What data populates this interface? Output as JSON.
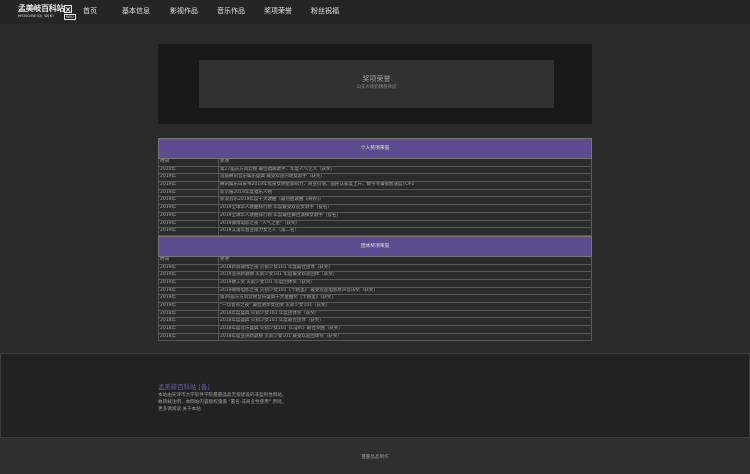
{
  "nav": {
    "logo_main": "孟美岐百科站",
    "logo_sub": "MENGMEIQI WIKI",
    "logo_tag": "WIKI",
    "items": [
      {
        "label": "首页"
      },
      {
        "label": "基本信息"
      },
      {
        "label": "影视作品"
      },
      {
        "label": "音乐作品"
      },
      {
        "label": "奖项荣誉"
      },
      {
        "label": "粉丝祝福"
      }
    ]
  },
  "banner": {
    "title": "奖项荣誉",
    "subtitle": "山支大岐奶精粉禅说"
  },
  "personal": {
    "heading": "个人奖项荣誉",
    "col_time": "时间",
    "col_award": "奖项",
    "rows": [
      {
        "time": "2020年",
        "award": "第27届东方风云榜 最佳唱跳歌手、年度人气艺人（获奖）"
      },
      {
        "time": "2019年",
        "award": "首届腾讯音乐娱乐盛典 最受欢迎内地女歌手（获奖）"
      },
      {
        "time": "2019年",
        "award": "腾讯娱乐白皮书2019年优质女明星影响力、商业价值、国民认知度上升、数字专辑销售速度TOP1"
      },
      {
        "time": "2019年",
        "award": "新京报2019年度福乐人物"
      },
      {
        "time": "2019年",
        "award": "新浪音乐2019年度十大歌曲（最热血歌曲《奇妙》）"
      },
      {
        "time": "2019年",
        "award": "2019全球华人歌曲排行榜 年度最受欢迎女歌手（提名）"
      },
      {
        "time": "2019年",
        "award": "2019全球华人歌曲排行榜 年度最佳舞台演绎女歌手（提名）"
      },
      {
        "time": "2019年",
        "award": "2019微博电影之夜 \"人气之星\"（获奖）"
      },
      {
        "time": "2019年",
        "award": "2019艾漫年会业绩力女艺人（第二名）"
      }
    ]
  },
  "group": {
    "heading": "团体奖项荣誉",
    "col_time": "时间",
    "col_award": "奖项",
    "rows": [
      {
        "time": "2019年",
        "award": "2019新浪微博之夜 火箭少女101 年度最佳团体（获奖）"
      },
      {
        "time": "2019年",
        "award": "2019亚洲新歌榜 火箭少女101 年度最受欢迎团体（获奖）"
      },
      {
        "time": "2019年",
        "award": "2019硬工奖 火箭少女101 年度团体奖（获奖）"
      },
      {
        "time": "2019年",
        "award": "2019微博电影之夜 火箭少女101《卡路里》 最受欢迎电影原声音乐奖（获奖）"
      },
      {
        "time": "2019年",
        "award": "第26届东方风云榜音乐盛典十大金曲奖《卡路里》（获奖）"
      },
      {
        "time": "2019年",
        "award": "\"一切皆有之夜\" 最佳进步女团奖 火箭少女101（获奖）"
      },
      {
        "time": "2018年",
        "award": "2018年度盛典 火箭少女101 年度团体奖（获奖）"
      },
      {
        "time": "2018年",
        "award": "2018年度盛典 火箭少女101 年度最佳团体（获奖）"
      },
      {
        "time": "2018年",
        "award": "2018年度音乐盛典 火箭少女101《Light》最佳单曲（获奖）"
      },
      {
        "time": "2018年",
        "award": "2018年度亚洲新歌榜 火箭少女101 最受欢迎团体奖（获奖）"
      }
    ]
  },
  "footer": {
    "title": "孟美岐百科站 [备]",
    "lines": [
      "本站由天津市大学软件学院蔓蔓晶晶无偿建设的非盈利性网站。",
      "故转载注明，本网站内容版权遵循 \"署名-非商业性使用\" 原则。",
      "更多请阅读 关于本站"
    ],
    "credit": "蔓蔓晶晶制作"
  }
}
